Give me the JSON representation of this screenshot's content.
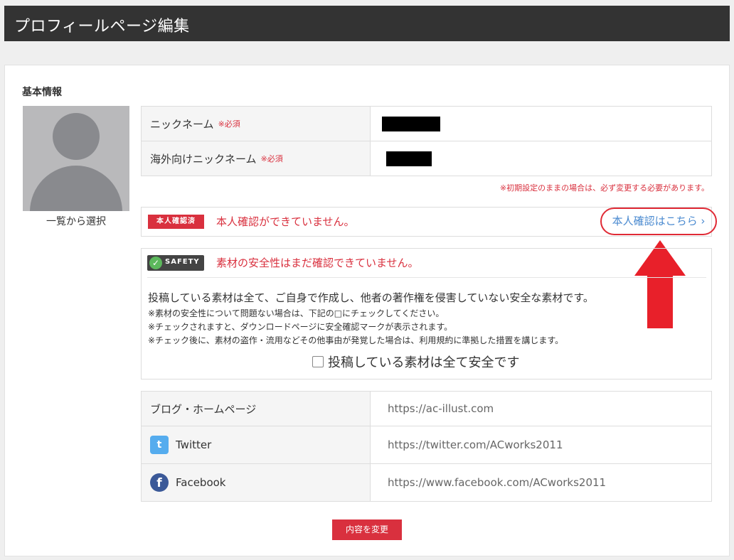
{
  "header": {
    "title": "プロフィールページ編集"
  },
  "basic": {
    "section_title": "基本情報",
    "avatar_label": "一覧から選択",
    "nickname_label": "ニックネーム",
    "required": "※必須",
    "overseas_label": "海外向けニックネーム",
    "note": "※初期設定のままの場合は、必ず変更する必要があります。"
  },
  "verify": {
    "badge": "本人確認済",
    "status": "本人確認ができていません。",
    "link": "本人確認はこちら ›"
  },
  "safety": {
    "badge": "SAFETY",
    "status": "素材の安全性はまだ確認できていません。",
    "main": "投稿している素材は全て、ご自身で作成し、他者の著作権を侵害していない安全な素材です。",
    "note1": "※素材の安全性について問題ない場合は、下記の□にチェックしてください。",
    "note2": "※チェックされますと、ダウンロードページに安全確認マークが表示されます。",
    "note3": "※チェック後に、素材の盗作・流用などその他事由が発覚した場合は、利用規約に準拠した措置を講じます。",
    "checkbox_label": "投稿している素材は全て安全です"
  },
  "links": {
    "blog_label": "ブログ・ホームページ",
    "blog_url": "https://ac-illust.com",
    "twitter_label": "Twitter",
    "twitter_url": "https://twitter.com/ACworks2011",
    "facebook_label": "Facebook",
    "facebook_url": "https://www.facebook.com/ACworks2011"
  },
  "submit_label": "内容を変更",
  "colors": {
    "accent_red": "#d9303e",
    "link_blue": "#4a8ad0",
    "header_bg": "#333333"
  }
}
